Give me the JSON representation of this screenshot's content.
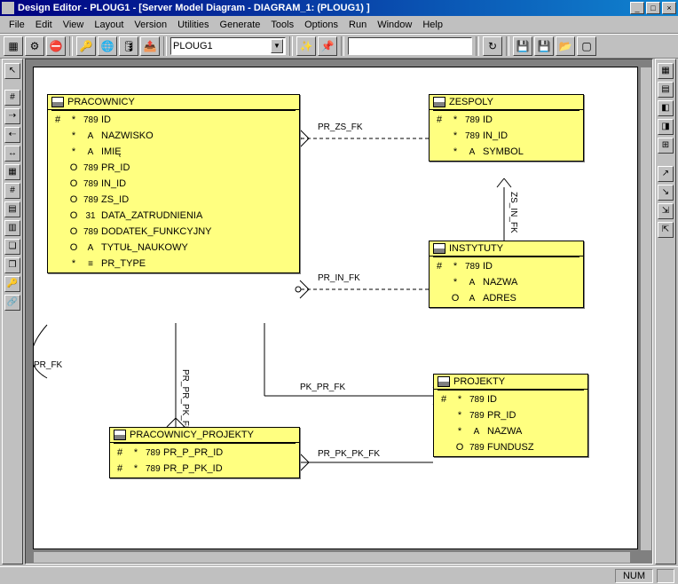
{
  "window": {
    "title": "Design Editor - PLOUG1 - [Server Model Diagram - DIAGRAM_1: (PLOUG1) ]"
  },
  "menu": {
    "items": [
      "File",
      "Edit",
      "View",
      "Layout",
      "Version",
      "Utilities",
      "Generate",
      "Tools",
      "Options",
      "Run",
      "Window",
      "Help"
    ]
  },
  "toolbar": {
    "combo_value": "PLOUG1",
    "textfield_value": ""
  },
  "status": {
    "num": "NUM"
  },
  "relationships": [
    {
      "name": "PR_ZS_FK"
    },
    {
      "name": "PR_IN_FK"
    },
    {
      "name": "PK_PR_FK"
    },
    {
      "name": "PR_PK_PK_FK"
    },
    {
      "name": "PR_PR_PK_FK"
    },
    {
      "name": "PR_FK"
    },
    {
      "name": "ZS_IN_FK"
    }
  ],
  "entities": {
    "zespoly": {
      "title": "ZESPOLY",
      "rows": [
        {
          "key": "#",
          "null": "*",
          "type": "789",
          "name": "ID"
        },
        {
          "key": "",
          "null": "*",
          "type": "789",
          "name": "IN_ID"
        },
        {
          "key": "",
          "null": "*",
          "type": "A",
          "name": "SYMBOL"
        }
      ]
    },
    "instytuty": {
      "title": "INSTYTUTY",
      "rows": [
        {
          "key": "#",
          "null": "*",
          "type": "789",
          "name": "ID"
        },
        {
          "key": "",
          "null": "*",
          "type": "A",
          "name": "NAZWA"
        },
        {
          "key": "",
          "null": "O",
          "type": "A",
          "name": "ADRES"
        }
      ]
    },
    "projekty": {
      "title": "PROJEKTY",
      "rows": [
        {
          "key": "#",
          "null": "*",
          "type": "789",
          "name": "ID"
        },
        {
          "key": "",
          "null": "*",
          "type": "789",
          "name": "PR_ID"
        },
        {
          "key": "",
          "null": "*",
          "type": "A",
          "name": "NAZWA"
        },
        {
          "key": "",
          "null": "O",
          "type": "789",
          "name": "FUNDUSZ"
        }
      ]
    },
    "pracownicy": {
      "title": "PRACOWNICY",
      "rows": [
        {
          "key": "#",
          "null": "*",
          "type": "789",
          "name": "ID"
        },
        {
          "key": "",
          "null": "*",
          "type": "A",
          "name": "NAZWISKO"
        },
        {
          "key": "",
          "null": "*",
          "type": "A",
          "name": "IMIĘ"
        },
        {
          "key": "",
          "null": "O",
          "type": "789",
          "name": "PR_ID"
        },
        {
          "key": "",
          "null": "O",
          "type": "789",
          "name": "IN_ID"
        },
        {
          "key": "",
          "null": "O",
          "type": "789",
          "name": "ZS_ID"
        },
        {
          "key": "",
          "null": "O",
          "type": "31",
          "name": "DATA_ZATRUDNIENIA"
        },
        {
          "key": "",
          "null": "O",
          "type": "789",
          "name": "DODATEK_FUNKCYJNY"
        },
        {
          "key": "",
          "null": "O",
          "type": "A",
          "name": "TYTUŁ_NAUKOWY"
        },
        {
          "key": "",
          "null": "*",
          "type": "≡",
          "name": "PR_TYPE"
        }
      ]
    },
    "prac_proj": {
      "title": "PRACOWNICY_PROJEKTY",
      "rows": [
        {
          "key": "#",
          "null": "*",
          "type": "789",
          "name": "PR_P_PR_ID"
        },
        {
          "key": "#",
          "null": "*",
          "type": "789",
          "name": "PR_P_PK_ID"
        }
      ]
    }
  }
}
